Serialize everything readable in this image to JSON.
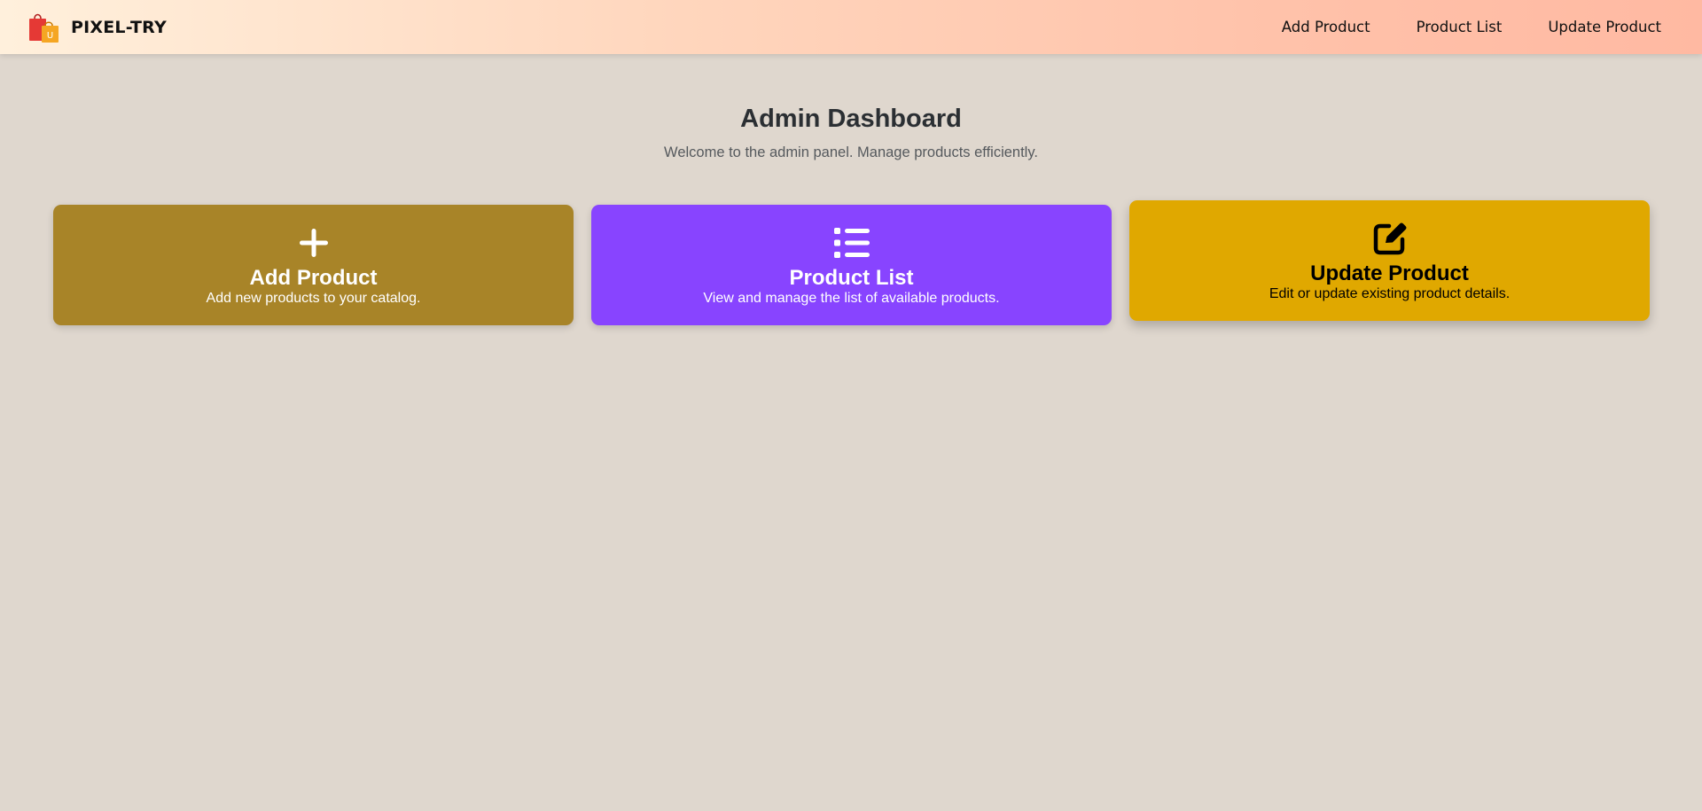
{
  "brand": {
    "name": "PIXEL-TRY",
    "logo_icon": "shopping-bags-icon"
  },
  "nav": {
    "links": [
      {
        "label": "Add Product"
      },
      {
        "label": "Product List"
      },
      {
        "label": "Update Product"
      }
    ]
  },
  "header": {
    "title": "Admin Dashboard",
    "subtitle": "Welcome to the admin panel. Manage products efficiently."
  },
  "cards": [
    {
      "icon": "plus-icon",
      "title": "Add Product",
      "description": "Add new products to your catalog.",
      "color": "#a88428"
    },
    {
      "icon": "list-icon",
      "title": "Product List",
      "description": "View and manage the list of available products.",
      "color": "#8844ff"
    },
    {
      "icon": "edit-icon",
      "title": "Update Product",
      "description": "Edit or update existing product details.",
      "color": "#e0a800"
    }
  ]
}
